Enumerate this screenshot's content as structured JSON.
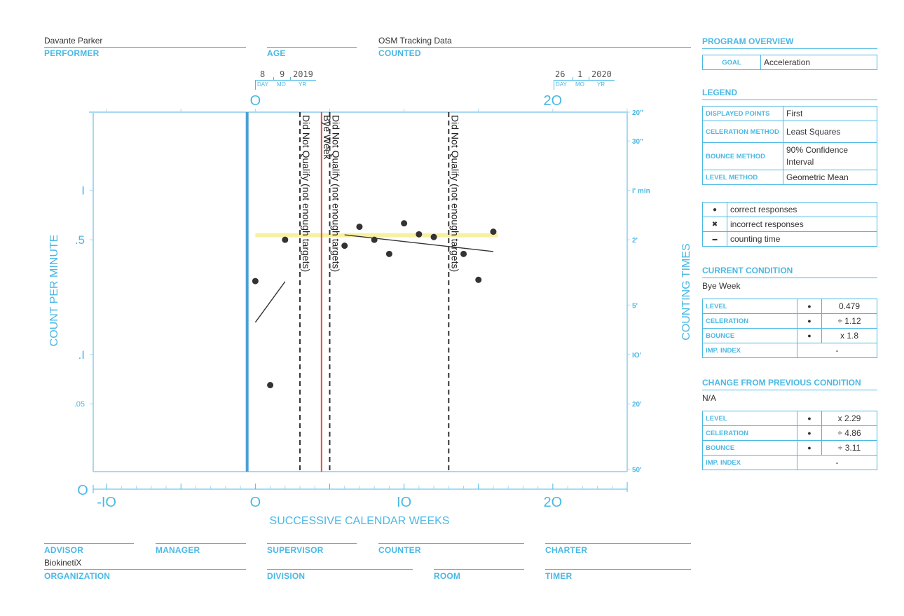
{
  "header": {
    "performer_value": "Davante Parker",
    "performer_label": "PERFORMER",
    "age_label": "AGE",
    "counted_value": "OSM Tracking Data",
    "counted_label": "COUNTED"
  },
  "dates": [
    {
      "day": "8",
      "month": "9",
      "year": "2019",
      "week": 0
    },
    {
      "day": "26",
      "month": "1",
      "year": "2020",
      "week": 20
    }
  ],
  "date_sublabels": {
    "day": "DAY",
    "month": "MO",
    "year": "YR"
  },
  "footer": {
    "advisor_label": "ADVISOR",
    "manager_label": "MANAGER",
    "supervisor_label": "SUPERVISOR",
    "counter_label": "COUNTER",
    "charter_label": "CHARTER",
    "organization_value": "BiokinetiX",
    "organization_label": "ORGANIZATION",
    "division_label": "DIVISION",
    "room_label": "ROOM",
    "timer_label": "TIMER"
  },
  "program_overview": {
    "title": "PROGRAM OVERVIEW",
    "goal_label": "GOAL",
    "goal_value": "Acceleration"
  },
  "legend": {
    "title": "LEGEND",
    "rows": [
      {
        "label": "DISPLAYED POINTS",
        "value": "First"
      },
      {
        "label": "CELERATION METHOD",
        "value": "Least Squares"
      },
      {
        "label": "BOUNCE METHOD",
        "value": "90% Confidence Interval"
      },
      {
        "label": "LEVEL METHOD",
        "value": "Geometric Mean"
      }
    ],
    "symbols": [
      {
        "icon": "dot-icon",
        "glyph": "●",
        "label": "correct responses"
      },
      {
        "icon": "x-icon",
        "glyph": "✖",
        "label": "incorrect responses"
      },
      {
        "icon": "dash-icon",
        "glyph": "▬",
        "label": "counting time"
      }
    ]
  },
  "current_condition": {
    "title": "CURRENT CONDITION",
    "name": "Bye Week",
    "rows": [
      {
        "label": "LEVEL",
        "symbol": "●",
        "value": "0.479"
      },
      {
        "label": "CELERATION",
        "symbol": "●",
        "value": "÷ 1.12"
      },
      {
        "label": "BOUNCE",
        "symbol": "●",
        "value": "x 1.8"
      },
      {
        "label": "IMP. INDEX",
        "symbol": "",
        "value": "-"
      }
    ]
  },
  "change_from_previous": {
    "title": "CHANGE FROM PREVIOUS CONDITION",
    "name": "N/A",
    "rows": [
      {
        "label": "LEVEL",
        "symbol": "●",
        "value": "x 2.29"
      },
      {
        "label": "CELERATION",
        "symbol": "●",
        "value": "÷ 4.86"
      },
      {
        "label": "BOUNCE",
        "symbol": "●",
        "value": "÷ 3.11"
      },
      {
        "label": "IMP. INDEX",
        "symbol": "",
        "value": "-"
      }
    ]
  },
  "colors": {
    "accent": "#4ab8e4",
    "frame": "#a7d8f0",
    "start_line": "#4a9fd5",
    "phase_line": "#e05040",
    "level_band": "#f7f0a0",
    "points": "#333333"
  },
  "chart_data": {
    "type": "scatter",
    "title": "",
    "xlabel": "SUCCESSIVE CALENDAR WEEKS",
    "ylabel": "COUNT PER MINUTE",
    "ylabel_right": "COUNTING TIMES",
    "xlim": [
      -10.9,
      25
    ],
    "ylim": [
      0.0193,
      3
    ],
    "yscale": "log",
    "grid": false,
    "x_ticks_bottom": [
      -10,
      0,
      10,
      20
    ],
    "x_tick_labels_bottom": [
      "-IO",
      "O",
      "IO",
      "2O"
    ],
    "x_ticks_top": [
      0,
      20
    ],
    "x_tick_labels_top": [
      "O",
      "2O"
    ],
    "zero_label": "O",
    "y_ticks_left": [
      1,
      0.5,
      0.1,
      0.05
    ],
    "y_tick_labels_left": [
      "I",
      ".5",
      ".I",
      ".05"
    ],
    "y_ticks_right": [
      3,
      2,
      1,
      0.5,
      0.2,
      0.1,
      0.05,
      0.02
    ],
    "y_tick_labels_right": [
      "20\"",
      "30\"",
      "I' min",
      "2'",
      "5'",
      "IO'",
      "20'",
      "50'"
    ],
    "series": [
      {
        "name": "correct responses",
        "marker": "dot",
        "x": [
          0,
          1,
          2,
          6,
          7,
          8,
          9,
          10,
          11,
          12,
          14,
          15,
          16
        ],
        "y": [
          0.28,
          0.065,
          0.5,
          0.46,
          0.6,
          0.5,
          0.41,
          0.63,
          0.54,
          0.52,
          0.41,
          0.285,
          0.56
        ]
      }
    ],
    "celeration_lines": [
      {
        "x": [
          0,
          2
        ],
        "y": [
          0.157,
          0.278
        ]
      },
      {
        "x": [
          6,
          16
        ],
        "y": [
          0.536,
          0.424
        ]
      }
    ],
    "level_band": {
      "x": [
        0,
        16.3
      ],
      "y": 0.533
    },
    "start_line": {
      "x": -0.55
    },
    "phase_lines": [
      {
        "x": 3,
        "style": "dashed",
        "label": "Did Not Qualify (not enough targets)"
      },
      {
        "x": 4.45,
        "style": "solid-red",
        "label": "Bye Week"
      },
      {
        "x": 5,
        "style": "dashed",
        "label": "Did Not Qualify (not enough targets)"
      },
      {
        "x": 13,
        "style": "dashed",
        "label": "Did Not Qualify (not enough targets)"
      }
    ]
  }
}
